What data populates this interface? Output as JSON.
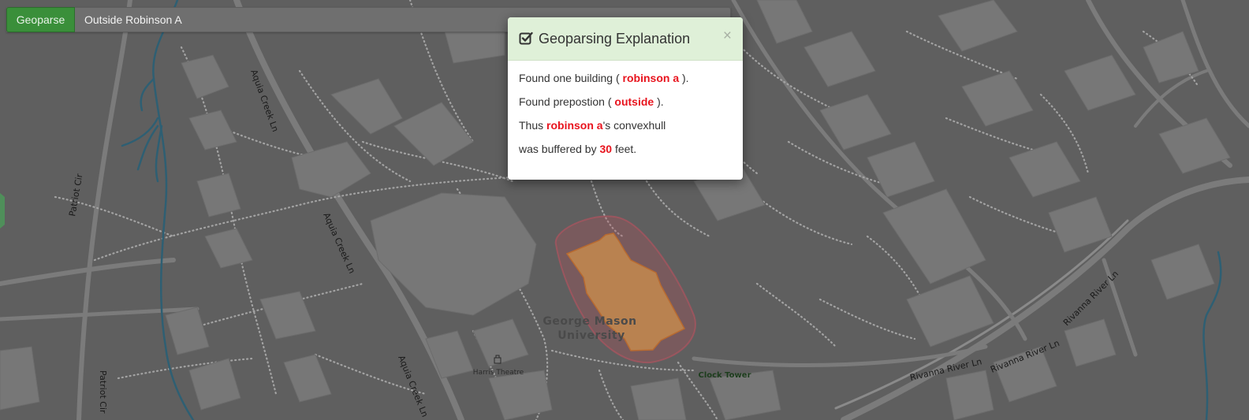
{
  "search": {
    "button_label": "Geoparse",
    "query": "Outside Robinson A"
  },
  "modal": {
    "title": "Geoparsing Explanation",
    "close_symbol": "×",
    "icon": "check-square-icon",
    "line1": {
      "prefix": "Found one building ( ",
      "value": "robinson a",
      "suffix": " )."
    },
    "line2": {
      "prefix": "Found prepostion ( ",
      "value": "outside",
      "suffix": " )."
    },
    "line3": {
      "prefix": "Thus ",
      "value": "robinson a",
      "suffix": "'s convexhull"
    },
    "line4": {
      "prefix": "was buffered by ",
      "value": "30",
      "suffix": " feet."
    }
  },
  "map": {
    "street_labels": {
      "aquia_creek_1": "Aquia Creek Ln",
      "aquia_creek_2": "Aquia Creek Ln",
      "aquia_creek_3": "Aquia Creek Ln",
      "patriot_cir_1": "Patriot Cir",
      "patriot_cir_2": "Patriot Cir",
      "rivanna_river_1": "Rivanna River Ln",
      "rivanna_river_2": "Rivanna River Ln",
      "rivanna_river_3": "Rivanna River Ln"
    },
    "poi_labels": {
      "university_line1": "George Mason",
      "university_line2": "University",
      "harris_theatre": "Harris Theatre",
      "clock_tower": "Clock Tower"
    },
    "colors": {
      "background": "#5f5f5f",
      "building": "#777777",
      "road": "#7d7d7d",
      "footpath": "#9a9a9a",
      "stream": "#2e5f73",
      "buffer_fill": "#c0505a",
      "building_highlight": "#c48a4e",
      "accent_green": "#3a8f3a"
    }
  }
}
